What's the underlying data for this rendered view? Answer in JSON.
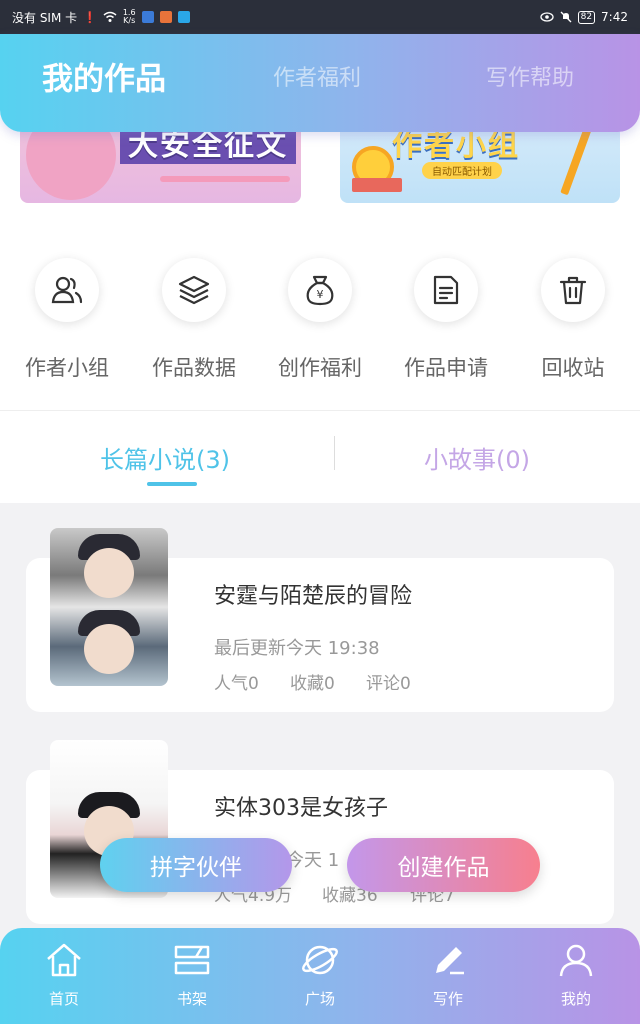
{
  "status_bar": {
    "carrier": "没有 SIM 卡",
    "net_speed_top": "1.6",
    "net_speed_bottom": "K/s",
    "battery": "82",
    "time": "7:42"
  },
  "header": {
    "tabs": [
      {
        "label": "我的作品",
        "active": true
      },
      {
        "label": "作者福利",
        "active": false
      },
      {
        "label": "写作帮助",
        "active": false
      }
    ]
  },
  "banners": [
    {
      "text": "大安全征文",
      "icon": "banner-illustration"
    },
    {
      "text": "作者小组",
      "chip": "自动匹配计划",
      "icon": "banner-illustration"
    }
  ],
  "shortcuts": [
    {
      "label": "作者小组",
      "icon": "group-icon"
    },
    {
      "label": "作品数据",
      "icon": "layers-icon"
    },
    {
      "label": "创作福利",
      "icon": "money-bag-icon"
    },
    {
      "label": "作品申请",
      "icon": "document-icon"
    },
    {
      "label": "回收站",
      "icon": "trash-icon"
    }
  ],
  "segments": [
    {
      "label": "长篇小说(3)",
      "active": true
    },
    {
      "label": "小故事(0)",
      "active": false
    }
  ],
  "works": [
    {
      "title": "安霆与陌楚辰的冒险",
      "updated": "最后更新今天 19:38",
      "popularity": "人气0",
      "favorites": "收藏0",
      "comments": "评论0"
    },
    {
      "title": "实体303是女孩子",
      "updated": "最后更新今天 1",
      "popularity": "人气4.9万",
      "favorites": "收藏36",
      "comments": "评论7"
    }
  ],
  "floating_buttons": {
    "partner": "拼字伙伴",
    "create": "创建作品"
  },
  "bottom_nav": [
    {
      "label": "首页",
      "icon": "home-icon"
    },
    {
      "label": "书架",
      "icon": "bookshelf-icon"
    },
    {
      "label": "广场",
      "icon": "planet-icon"
    },
    {
      "label": "写作",
      "icon": "pen-icon",
      "active": true
    },
    {
      "label": "我的",
      "icon": "user-icon"
    }
  ],
  "colors": {
    "accent_blue": "#4fc3e8",
    "accent_purple": "#b893e6",
    "accent_pink": "#f77f8e"
  }
}
